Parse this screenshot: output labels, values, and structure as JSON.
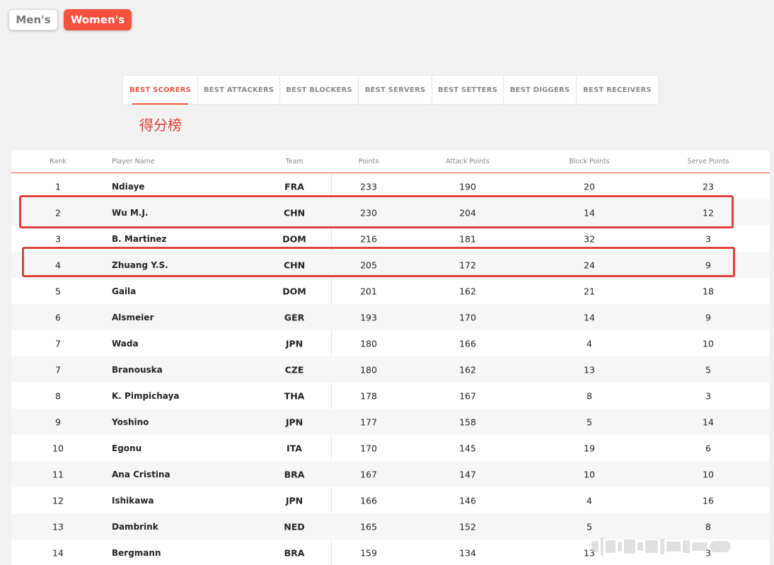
{
  "gender_toggle": {
    "men_label": "Men's",
    "women_label": "Women's"
  },
  "tabs": [
    {
      "label": "BEST SCORERS",
      "active": true
    },
    {
      "label": "BEST ATTACKERS",
      "active": false
    },
    {
      "label": "BEST BLOCKERS",
      "active": false
    },
    {
      "label": "BEST SERVERS",
      "active": false
    },
    {
      "label": "BEST SETTERS",
      "active": false
    },
    {
      "label": "BEST DIGGERS",
      "active": false
    },
    {
      "label": "BEST RECEIVERS",
      "active": false
    }
  ],
  "annotation": "得分榜",
  "table": {
    "headers": [
      "Rank",
      "Player Name",
      "Team",
      "Points",
      "Attack Points",
      "Block Points",
      "Serve Points"
    ],
    "rows": [
      [
        "1",
        "Ndiaye",
        "FRA",
        "233",
        "190",
        "20",
        "23"
      ],
      [
        "2",
        "Wu M.J.",
        "CHN",
        "230",
        "204",
        "14",
        "12"
      ],
      [
        "3",
        "B. Martinez",
        "DOM",
        "216",
        "181",
        "32",
        "3"
      ],
      [
        "4",
        "Zhuang Y.S.",
        "CHN",
        "205",
        "172",
        "24",
        "9"
      ],
      [
        "5",
        "Gaila",
        "DOM",
        "201",
        "162",
        "21",
        "18"
      ],
      [
        "6",
        "Alsmeier",
        "GER",
        "193",
        "170",
        "14",
        "9"
      ],
      [
        "7",
        "Wada",
        "JPN",
        "180",
        "166",
        "4",
        "10"
      ],
      [
        "7",
        "Branouska",
        "CZE",
        "180",
        "162",
        "13",
        "5"
      ],
      [
        "8",
        "K. Pimpichaya",
        "THA",
        "178",
        "167",
        "8",
        "3"
      ],
      [
        "9",
        "Yoshino",
        "JPN",
        "177",
        "158",
        "5",
        "14"
      ],
      [
        "10",
        "Egonu",
        "ITA",
        "170",
        "145",
        "19",
        "6"
      ],
      [
        "11",
        "Ana Cristina",
        "BRA",
        "167",
        "147",
        "10",
        "10"
      ],
      [
        "12",
        "Ishikawa",
        "JPN",
        "166",
        "146",
        "4",
        "16"
      ],
      [
        "13",
        "Dambrink",
        "NED",
        "165",
        "152",
        "5",
        "8"
      ],
      [
        "14",
        "Bergmann",
        "BRA",
        "159",
        "134",
        "13",
        "3"
      ]
    ]
  },
  "colors": {
    "accent": "#f4513e",
    "highlight": "#e0403a"
  }
}
